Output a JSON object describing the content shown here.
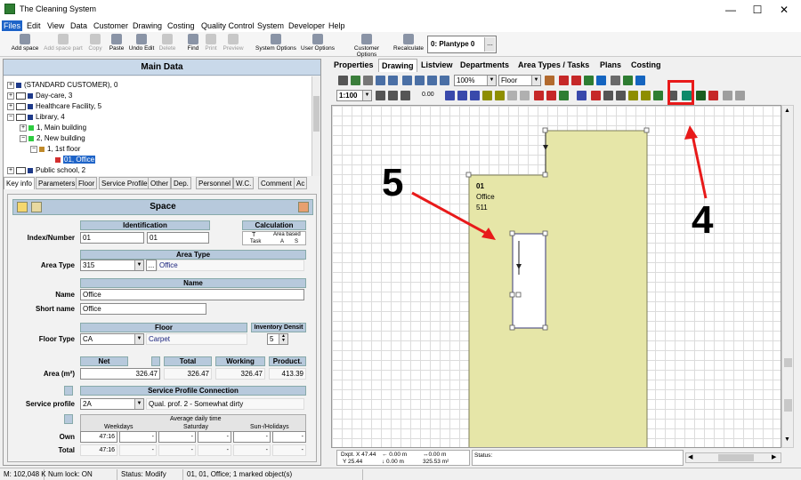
{
  "window": {
    "title": "The Cleaning System"
  },
  "menu": [
    "Files",
    "Edit",
    "View",
    "Data",
    "Customer",
    "Drawing",
    "Costing",
    "Quality Control",
    "System",
    "Developer",
    "Help"
  ],
  "toolbar": {
    "buttons": [
      "Add space",
      "Add space part",
      "Copy",
      "Paste",
      "Undo Edit",
      "Delete",
      "Find",
      "Print",
      "Preview",
      "System Options",
      "User Options",
      "Customer Options",
      "Recalculate"
    ],
    "plantype": "0: Plantype 0",
    "plantype_btn": "..."
  },
  "left_panel": {
    "title": "Main Data",
    "tree": [
      "(STANDARD CUSTOMER), 0",
      "Day-care, 3",
      "Healthcare Facility, 5",
      "Library, 4",
      "1, Main building",
      "2, New building",
      "1, 1st floor",
      "01, Office",
      "Public school, 2"
    ],
    "tabs": [
      "Key info",
      "Parameters",
      "Floor",
      "Service Profile",
      "Other",
      "Dep.",
      "Personnel",
      "W.C.",
      "Comment",
      "Ac"
    ]
  },
  "space_form": {
    "title": "Space",
    "identification_header": "Identification",
    "calculation_header": "Calculation",
    "calc_cols": [
      "T",
      "Area based"
    ],
    "calc_sub": [
      "Task",
      "A",
      "S"
    ],
    "index_label": "Index/Number",
    "index_value": "01",
    "number_value": "01",
    "area_type_header": "Area Type",
    "area_type_label": "Area Type",
    "area_type_code": "315",
    "area_type_btn": "...",
    "area_type_name": "Office",
    "name_header": "Name",
    "name_label": "Name",
    "name_value": "Office",
    "short_name_label": "Short name",
    "short_name_value": "Office",
    "floor_header": "Floor",
    "inventory_header": "Inventory Densit",
    "floor_type_label": "Floor Type",
    "floor_type_code": "CA",
    "floor_type_name": "Carpet",
    "inventory_value": "5",
    "net_header": "Net",
    "total_header": "Total",
    "working_header": "Working",
    "product_header": "Product.",
    "area_label": "Area (m²)",
    "net_value": "326.47",
    "total_value": "326.47",
    "working_value": "326.47",
    "product_value": "413.39",
    "service_header": "Service Profile Connection",
    "service_label": "Service profile",
    "service_code": "2A",
    "service_name": "Qual. prof. 2 - Somewhat dirty",
    "avg_header": "Average daily time",
    "day_cols": [
      "Weekdays",
      "Saturday",
      "Sun-/Holidays"
    ],
    "own_label": "Own",
    "total_label": "Total",
    "own_values": [
      "47:16",
      "-",
      "-",
      "-",
      "-",
      "-"
    ],
    "total_values": [
      "47:16",
      "-",
      "-",
      "-",
      "-",
      "-"
    ]
  },
  "right_panel": {
    "tabs": [
      "Properties",
      "Drawing",
      "Listview",
      "Departments",
      "Area Types / Tasks",
      "Plans",
      "Costing"
    ],
    "zoom": "100%",
    "layer": "Floor",
    "scale": "1:100",
    "zero": "0.00",
    "space_label": {
      "number": "01",
      "name": "Office",
      "area_type": "511"
    },
    "annotation_5": "5",
    "annotation_4": "4",
    "coords": {
      "dx": "Dxpt. X 47.44",
      "dy": "Y 25.44",
      "dx2": "← 0.00 m",
      "dy2": "↓ 0.00 m",
      "a1": "↔0.00 m",
      "a2": "325.53 m²"
    },
    "status_label": "Status:"
  },
  "statusbar": [
    "M: 102,048 K",
    "Num lock: ON",
    "Status: Modify",
    "01, 01, Office; 1 marked object(s)"
  ],
  "colors": {
    "accent": "#1e64c8",
    "plan_fill": "#e6e6a8",
    "annotation": "#e81a1a"
  }
}
